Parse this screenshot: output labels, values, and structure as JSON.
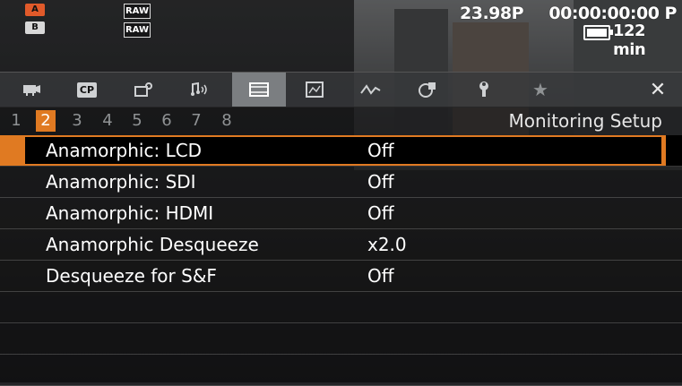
{
  "status": {
    "badge_a": "A",
    "badge_b": "B",
    "raw_1": "RAW",
    "raw_2": "RAW",
    "frame_rate": "23.98P",
    "timecode": "00:00:00:00 P",
    "remaining": "122 min"
  },
  "tabs": [
    {
      "icon": "camera-icon"
    },
    {
      "icon": "cp-icon",
      "label": "CP"
    },
    {
      "icon": "camera-setup-icon"
    },
    {
      "icon": "audio-icon"
    },
    {
      "icon": "monitoring-setup-icon"
    },
    {
      "icon": "recording-media-icon"
    },
    {
      "icon": "waveform-icon"
    },
    {
      "icon": "assist-icon"
    },
    {
      "icon": "wrench-icon"
    },
    {
      "icon": "star-icon"
    },
    {
      "icon": "close-icon"
    }
  ],
  "pages": [
    "1",
    "2",
    "3",
    "4",
    "5",
    "6",
    "7",
    "8"
  ],
  "active_page": "2",
  "section_title": "Monitoring Setup",
  "menu": [
    {
      "label": "Anamorphic: LCD",
      "value": "Off"
    },
    {
      "label": "Anamorphic: SDI",
      "value": "Off"
    },
    {
      "label": "Anamorphic: HDMI",
      "value": "Off"
    },
    {
      "label": "Anamorphic Desqueeze",
      "value": "x2.0"
    },
    {
      "label": "Desqueeze for S&F",
      "value": "Off"
    }
  ],
  "colors": {
    "accent": "#e07a22"
  }
}
